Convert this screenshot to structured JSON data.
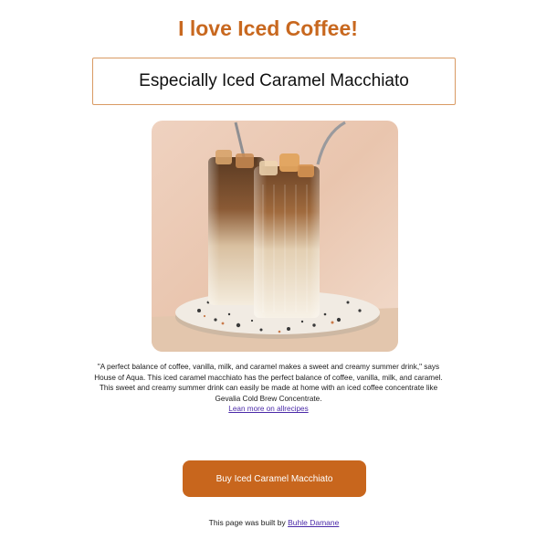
{
  "header": {
    "title": "I love Iced Coffee!",
    "subtitle": "Especially Iced Caramel Macchiato"
  },
  "hero_image": {
    "alt": "Two glasses of iced caramel macchiato with metal straws on a terrazzo coaster"
  },
  "description": {
    "text": "\"A perfect balance of coffee, vanilla, milk, and caramel makes a sweet and creamy summer drink,\" says House of Aqua. This iced caramel macchiato has the perfect balance of coffee, vanilla, milk, and caramel. This sweet and creamy summer drink can easily be made at home with an iced coffee concentrate like Gevalia Cold Brew Concentrate.",
    "link_label": "Lean more on allrecipes"
  },
  "cta": {
    "label": "Buy Iced Caramel Macchiato"
  },
  "footer": {
    "prefix": "This page was built by ",
    "author": "Buhle Damane"
  },
  "colors": {
    "accent": "#c8681f",
    "button": "#c8661d",
    "link": "#4b2aa8",
    "box_border": "#d99a63"
  }
}
